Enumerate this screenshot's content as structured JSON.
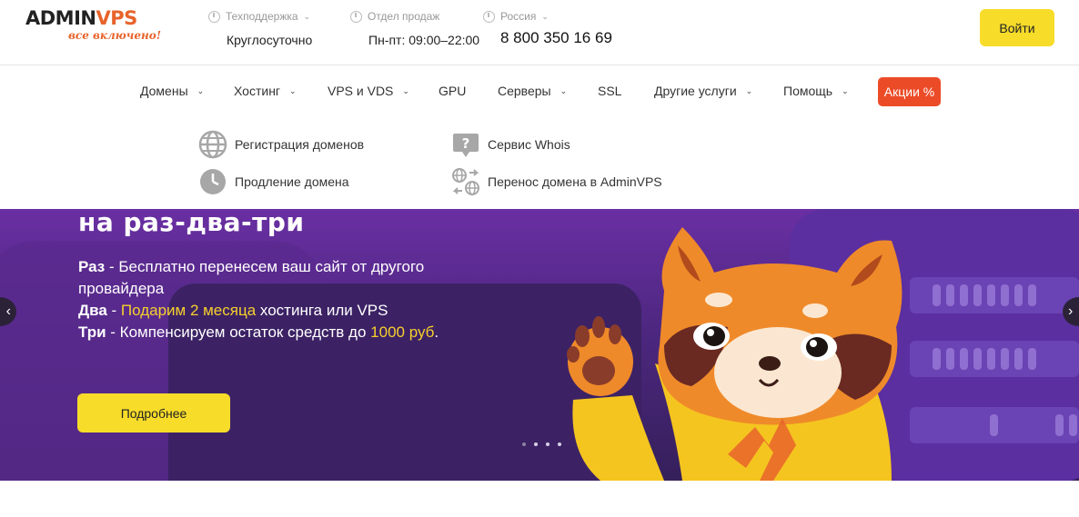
{
  "logo": {
    "brand_prefix": "ADMIN",
    "brand_suffix": "VPS",
    "tagline": "все включено!"
  },
  "header": {
    "support": {
      "label": "Техподдержка",
      "value": "Круглосуточно"
    },
    "sales": {
      "label": "Отдел продаж",
      "value": "Пн-пт: 09:00–22:00"
    },
    "region": {
      "label": "Россия",
      "phone": "8 800 350 16 69"
    },
    "login_label": "Войти"
  },
  "nav": {
    "items": [
      {
        "label": "Домены",
        "dropdown": true
      },
      {
        "label": "Хостинг",
        "dropdown": true
      },
      {
        "label": "VPS и VDS",
        "dropdown": true
      },
      {
        "label": "GPU",
        "dropdown": false
      },
      {
        "label": "Серверы",
        "dropdown": true
      },
      {
        "label": "SSL",
        "dropdown": false
      },
      {
        "label": "Другие услуги",
        "dropdown": true
      },
      {
        "label": "Помощь",
        "dropdown": true
      }
    ],
    "promo_label": "Акции %"
  },
  "domains_menu": {
    "items": [
      {
        "label": "Регистрация доменов",
        "icon": "globe-icon"
      },
      {
        "label": "Продление домена",
        "icon": "clock-icon"
      },
      {
        "label": "Сервис Whois",
        "icon": "question-bubble-icon"
      },
      {
        "label": "Перенос домена в AdminVPS",
        "icon": "transfer-globes-icon"
      }
    ]
  },
  "banner": {
    "title": "на раз-два-три",
    "line1_bold": "Раз",
    "line1_text": " - Бесплатно перенесем ваш сайт от другого провайдера",
    "line2_bold": "Два",
    "line2_dash": " - ",
    "line2_highlight": "Подарим 2 месяца",
    "line2_text": " хостинга или VPS",
    "line3_bold": "Три",
    "line3_text": " - Компенсируем остаток средств до ",
    "line3_highlight": "1000 руб",
    "line3_end": ".",
    "button_label": "Подробнее",
    "slides_count": 4,
    "active_slide": 1
  },
  "colors": {
    "accent_yellow": "#f7dc2a",
    "accent_orange": "#ec4b27",
    "banner_purple": "#4d2780",
    "highlight": "#f7d02c"
  }
}
